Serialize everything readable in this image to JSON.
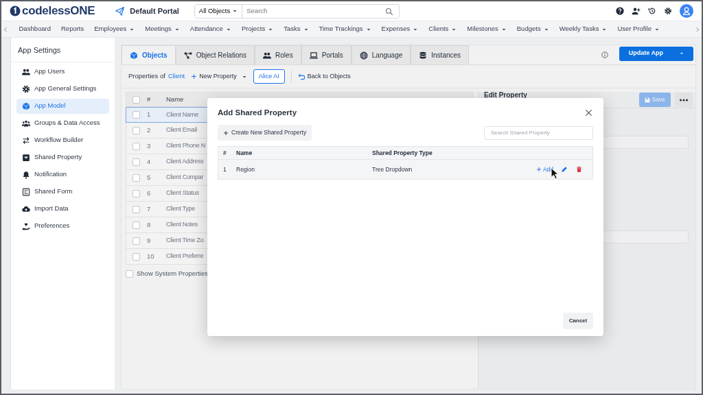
{
  "header": {
    "logo": "codelessONE",
    "portal": "Default Portal",
    "search_scope": "All Objects",
    "search_placeholder": "Search"
  },
  "nav": [
    {
      "label": "Dashboard",
      "dropdown": false
    },
    {
      "label": "Reports",
      "dropdown": false
    },
    {
      "label": "Employees",
      "dropdown": true
    },
    {
      "label": "Meetings",
      "dropdown": true
    },
    {
      "label": "Attendance",
      "dropdown": true
    },
    {
      "label": "Projects",
      "dropdown": true
    },
    {
      "label": "Tasks",
      "dropdown": true
    },
    {
      "label": "Time Trackings",
      "dropdown": true
    },
    {
      "label": "Expenses",
      "dropdown": true
    },
    {
      "label": "Clients",
      "dropdown": true
    },
    {
      "label": "Milestones",
      "dropdown": true
    },
    {
      "label": "Budgets",
      "dropdown": true
    },
    {
      "label": "Weekly Tasks",
      "dropdown": true
    },
    {
      "label": "User Profile",
      "dropdown": true
    }
  ],
  "sidebar": {
    "title": "App Settings",
    "items": [
      {
        "label": "App Users",
        "selected": false
      },
      {
        "label": "App General Settings",
        "selected": false
      },
      {
        "label": "App Model",
        "selected": true
      },
      {
        "label": "Groups & Data Access",
        "selected": false
      },
      {
        "label": "Workflow Builder",
        "selected": false
      },
      {
        "label": "Shared Property",
        "selected": false
      },
      {
        "label": "Notification",
        "selected": false
      },
      {
        "label": "Shared Form",
        "selected": false
      },
      {
        "label": "Import Data",
        "selected": false
      },
      {
        "label": "Preferences",
        "selected": false
      }
    ]
  },
  "tabs": [
    {
      "label": "Objects",
      "selected": true
    },
    {
      "label": "Object Relations",
      "selected": false
    },
    {
      "label": "Roles",
      "selected": false
    },
    {
      "label": "Portals",
      "selected": false
    },
    {
      "label": "Language",
      "selected": false
    },
    {
      "label": "Instances",
      "selected": false
    }
  ],
  "update_button": "Update App",
  "toolbar": {
    "prefix": "Properties of",
    "object": "Client",
    "new_property": "New Property",
    "ai_button": "Alice AI",
    "back": "Back to Objects"
  },
  "properties_table": {
    "all_checked": false,
    "columns": [
      "#",
      "Name"
    ],
    "rows": [
      {
        "number": "1",
        "name": "Client Name",
        "selected": true,
        "checked": false
      },
      {
        "number": "2",
        "name": "Client Email",
        "selected": false,
        "checked": false
      },
      {
        "number": "3",
        "name": "Client Phone N",
        "selected": false,
        "checked": false
      },
      {
        "number": "4",
        "name": "Client Address",
        "selected": false,
        "checked": false
      },
      {
        "number": "5",
        "name": "Client Compar",
        "selected": false,
        "checked": false
      },
      {
        "number": "6",
        "name": "Client Status",
        "selected": false,
        "checked": false
      },
      {
        "number": "7",
        "name": "Client Type",
        "selected": false,
        "checked": false
      },
      {
        "number": "8",
        "name": "Client Notes",
        "selected": false,
        "checked": false
      },
      {
        "number": "9",
        "name": "Client Time Zo",
        "selected": false,
        "checked": false
      },
      {
        "number": "10",
        "name": "Client Preferre",
        "selected": false,
        "checked": false
      }
    ]
  },
  "show_system": {
    "label": "Show System Properties",
    "checked": false
  },
  "edit_panel": {
    "title": "Edit Property",
    "save": "Save",
    "save_disabled": true
  },
  "modal": {
    "title": "Add Shared Property",
    "create_button": "Create New Shared Property",
    "search_placeholder": "Search Shared Property",
    "columns": [
      "#",
      "Name",
      "Shared Property Type"
    ],
    "rows": [
      {
        "number": "1",
        "name": "Region",
        "type": "Tree Dropdown",
        "add": "Add"
      }
    ],
    "cancel": "Cancel"
  }
}
